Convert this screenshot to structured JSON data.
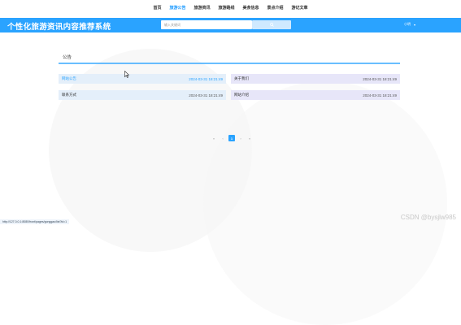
{
  "nav": {
    "items": [
      {
        "label": "首页",
        "active": false
      },
      {
        "label": "旅游公告",
        "active": true
      },
      {
        "label": "旅游资讯",
        "active": false
      },
      {
        "label": "旅游路线",
        "active": false
      },
      {
        "label": "美食信息",
        "active": false
      },
      {
        "label": "景点介绍",
        "active": false
      },
      {
        "label": "游记文章",
        "active": false
      }
    ]
  },
  "header": {
    "title": "个性化旅游资讯内容推荐系统",
    "search_placeholder": "输入关键词",
    "user_name": "小明",
    "user_caret": "▾"
  },
  "section": {
    "title": "公告"
  },
  "notices": [
    {
      "title": "网站公告",
      "date": "2024-03-31 18:21:49"
    },
    {
      "title": "关于我们",
      "date": "2024-03-31 18:21:49"
    },
    {
      "title": "联系方式",
      "date": "2024-03-31 18:21:49"
    },
    {
      "title": "网站介绍",
      "date": "2024-03-31 18:21:49"
    }
  ],
  "pagination": {
    "prev": "«",
    "prev_one": "‹",
    "current": "1",
    "next_one": "›",
    "next": "»"
  },
  "status_url": "http://127.0.0.1:8080/front/pages/gonggao/list?id=1",
  "watermark": "CSDN @bysjlw985",
  "colors": {
    "accent": "#2aa3ff",
    "card_blue": "#e4effa",
    "card_purple": "#e7e6f9"
  }
}
